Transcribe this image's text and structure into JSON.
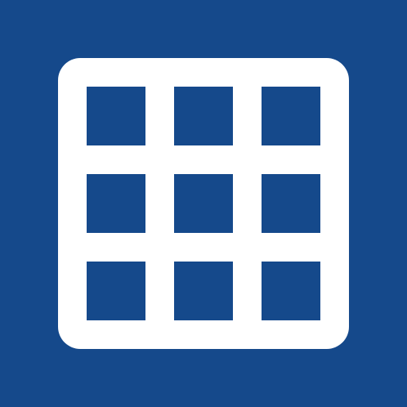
{
  "app_icon": {
    "icon": "grid-icon",
    "cells": 9,
    "colors": {
      "background": "#15498b",
      "foreground": "#ffffff"
    }
  }
}
